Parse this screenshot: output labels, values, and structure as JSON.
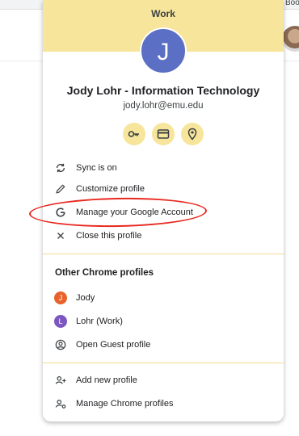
{
  "background": {
    "bookmarks_text": "Boo"
  },
  "profile": {
    "header_title": "Work",
    "avatar_letter": "J",
    "name": "Jody Lohr - Information Technology",
    "email": "jody.lohr@emu.edu",
    "quick_actions": [
      "key-icon",
      "card-icon",
      "location-icon"
    ]
  },
  "menu": {
    "sync": "Sync is on",
    "customize": "Customize profile",
    "manage_account": "Manage your Google Account",
    "close": "Close this profile"
  },
  "other_profiles": {
    "title": "Other Chrome profiles",
    "items": [
      {
        "letter": "J",
        "label": "Jody",
        "color": "#e8632b"
      },
      {
        "letter": "L",
        "label": "Lohr (Work)",
        "color": "#7d57c1"
      }
    ],
    "guest": "Open Guest profile"
  },
  "footer": {
    "add_profile": "Add new profile",
    "manage_profiles": "Manage Chrome profiles"
  },
  "colors": {
    "header_bg": "#f6e59a",
    "avatar_bg": "#5b6fc4",
    "annotation": "#e8281f"
  }
}
